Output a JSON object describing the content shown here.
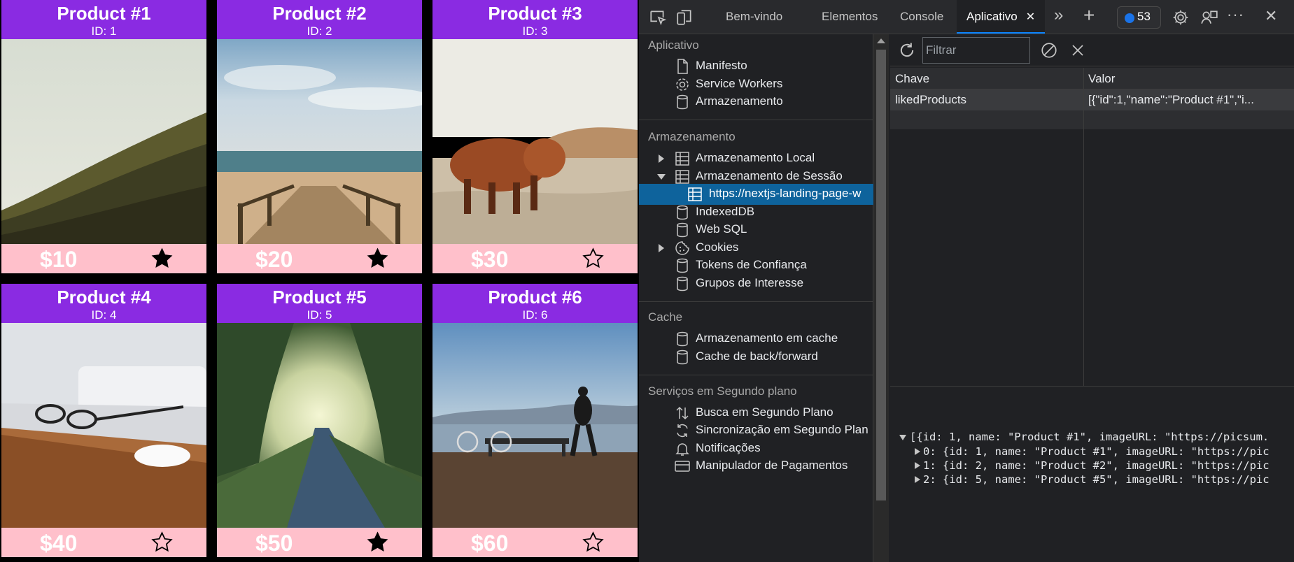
{
  "products": [
    {
      "name": "Product #1",
      "id_label": "ID: 1",
      "price": "$10",
      "liked": true,
      "scene": "hill"
    },
    {
      "name": "Product #2",
      "id_label": "ID: 2",
      "price": "$20",
      "liked": true,
      "scene": "beach"
    },
    {
      "name": "Product #3",
      "id_label": "ID: 3",
      "price": "$30",
      "liked": false,
      "scene": "cow"
    },
    {
      "name": "Product #4",
      "id_label": "ID: 4",
      "price": "$40",
      "liked": false,
      "scene": "desk"
    },
    {
      "name": "Product #5",
      "id_label": "ID: 5",
      "price": "$50",
      "liked": true,
      "scene": "road"
    },
    {
      "name": "Product #6",
      "id_label": "ID: 6",
      "price": "$60",
      "liked": false,
      "scene": "lake"
    }
  ],
  "devtools": {
    "tabs": {
      "welcome": "Bem-vindo",
      "elements": "Elementos",
      "console": "Console",
      "application": "Aplicativo",
      "close": "✕"
    },
    "more_tabs": "»",
    "add_tab": "+",
    "issues_count": "53",
    "more_menu": "···",
    "close_devtools": "✕",
    "sidebar": {
      "application_title": "Aplicativo",
      "application_items": [
        {
          "label": "Manifesto",
          "icon": "file-icon"
        },
        {
          "label": "Service Workers",
          "icon": "gear-icon"
        },
        {
          "label": "Armazenamento",
          "icon": "database-icon"
        }
      ],
      "storage_title": "Armazenamento",
      "storage_items": [
        {
          "label": "Armazenamento Local",
          "icon": "grid-icon",
          "expander": "collapsed"
        },
        {
          "label": "Armazenamento de Sessão",
          "icon": "grid-icon",
          "expander": "expanded"
        },
        {
          "label": "https://nextjs-landing-page-w",
          "icon": "grid-icon",
          "selected": true
        },
        {
          "label": "IndexedDB",
          "icon": "database-icon"
        },
        {
          "label": "Web SQL",
          "icon": "database-icon"
        },
        {
          "label": "Cookies",
          "icon": "cookie-icon",
          "expander": "collapsed"
        },
        {
          "label": "Tokens de Confiança",
          "icon": "database-icon"
        },
        {
          "label": "Grupos de Interesse",
          "icon": "database-icon"
        }
      ],
      "cache_title": "Cache",
      "cache_items": [
        {
          "label": "Armazenamento em cache",
          "icon": "database-icon"
        },
        {
          "label": "Cache de back/forward",
          "icon": "database-icon"
        }
      ],
      "background_title": "Serviços em Segundo plano",
      "background_items": [
        {
          "label": "Busca em Segundo Plano",
          "icon": "arrows-updown-icon"
        },
        {
          "label": "Sincronização em Segundo Plan",
          "icon": "sync-icon"
        },
        {
          "label": "Notificações",
          "icon": "bell-icon"
        },
        {
          "label": "Manipulador de Pagamentos",
          "icon": "card-icon"
        }
      ]
    },
    "storage_view": {
      "filter_placeholder": "Filtrar",
      "columns": {
        "key": "Chave",
        "value": "Valor"
      },
      "rows": [
        {
          "key": "likedProducts",
          "value": "[{\"id\":1,\"name\":\"Product #1\",\"i..."
        }
      ],
      "preview": {
        "root": "[{id: 1, name: \"Product #1\", imageURL: \"https://picsum.",
        "children": [
          "0: {id: 1, name: \"Product #1\", imageURL: \"https://pic",
          "1: {id: 2, name: \"Product #2\", imageURL: \"https://pic",
          "2: {id: 5, name: \"Product #5\", imageURL: \"https://pic"
        ]
      }
    }
  }
}
